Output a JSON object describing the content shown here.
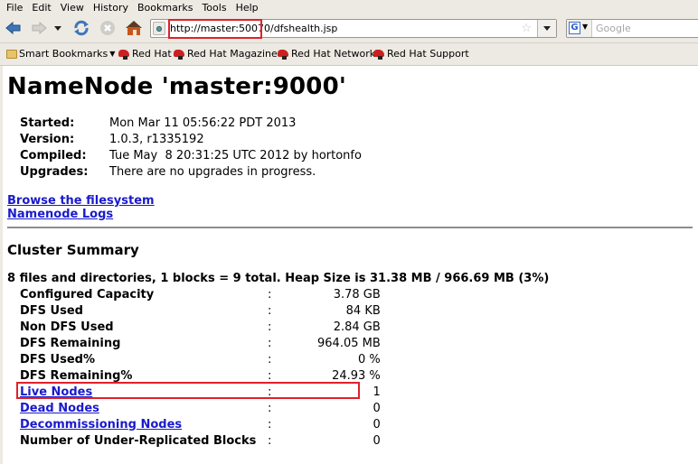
{
  "browser": {
    "menu": [
      {
        "label": "File",
        "accel": "F"
      },
      {
        "label": "Edit",
        "accel": "E"
      },
      {
        "label": "View",
        "accel": "V"
      },
      {
        "label": "History",
        "accel": "s"
      },
      {
        "label": "Bookmarks",
        "accel": "B"
      },
      {
        "label": "Tools",
        "accel": "T"
      },
      {
        "label": "Help",
        "accel": "H"
      }
    ],
    "menu_labels": {
      "file": "File",
      "edit": "Edit",
      "view": "View",
      "history": "History",
      "bookmarks": "Bookmarks",
      "tools": "Tools",
      "help": "Help"
    },
    "url": "http://master:50070/dfshealth.jsp",
    "search_placeholder": "Google",
    "search_engine": "G",
    "bookmarks": [
      {
        "label": "Smart Bookmarks",
        "icon": "folder-icon"
      },
      {
        "label": "Red Hat",
        "icon": "redhat-icon"
      },
      {
        "label": "Red Hat Magazine",
        "icon": "redhat-icon"
      },
      {
        "label": "Red Hat Network",
        "icon": "redhat-icon"
      },
      {
        "label": "Red Hat Support",
        "icon": "redhat-icon"
      }
    ],
    "highlight_color": "#e0202a"
  },
  "page": {
    "title": "NameNode 'master:9000'",
    "info": [
      {
        "key": "Started:",
        "value": "Mon Mar 11 05:56:22 PDT 2013"
      },
      {
        "key": "Version:",
        "value": "1.0.3, r1335192"
      },
      {
        "key": "Compiled:",
        "value": "Tue May  8 20:31:25 UTC 2012 by hortonfo"
      },
      {
        "key": "Upgrades:",
        "value": "There are no upgrades in progress."
      }
    ],
    "links": {
      "browse": "Browse the filesystem",
      "logs": "Namenode Logs"
    },
    "cluster_summary": {
      "heading": "Cluster Summary",
      "summary_line": "8 files and directories, 1 blocks = 9 total. Heap Size is 31.38 MB / 966.69 MB (3%)",
      "separator": ":",
      "stats": [
        {
          "label": "Configured Capacity",
          "value": "3.78 GB"
        },
        {
          "label": "DFS Used",
          "value": "84 KB"
        },
        {
          "label": "Non DFS Used",
          "value": "2.84 GB"
        },
        {
          "label": "DFS Remaining",
          "value": "964.05 MB"
        },
        {
          "label": "DFS Used%",
          "value": "0 %"
        },
        {
          "label": "DFS Remaining%",
          "value": "24.93 %"
        },
        {
          "label": "Live Nodes",
          "value": "1",
          "link": true
        },
        {
          "label": "Dead Nodes",
          "value": "0",
          "link": true
        },
        {
          "label": "Decommissioning Nodes",
          "value": "0",
          "link": true
        },
        {
          "label": "Number of Under-Replicated Blocks",
          "value": "0"
        }
      ]
    }
  }
}
